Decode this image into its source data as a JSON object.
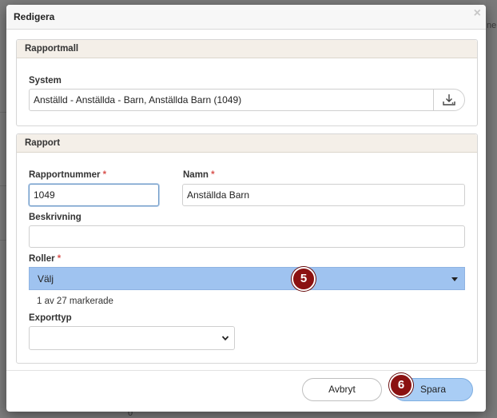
{
  "background": {
    "cut_text": "ne",
    "number": "0"
  },
  "dialog": {
    "title": "Redigera",
    "close_symbol": "×"
  },
  "section_template": {
    "heading": "Rapportmall",
    "system_label": "System",
    "system_value": "Anställd - Anställda - Barn, Anställda Barn (1049)"
  },
  "section_report": {
    "heading": "Rapport",
    "number_label": "Rapportnummer",
    "number_value": "1049",
    "name_label": "Namn",
    "name_value": "Anställda Barn",
    "description_label": "Beskrivning",
    "description_value": "",
    "roles_label": "Roller",
    "roles_selected": "Välj",
    "roles_count": "1 av 27 markerade",
    "export_label": "Exporttyp",
    "export_value": "",
    "required_mark": "*"
  },
  "footer": {
    "cancel_label": "Avbryt",
    "save_label": "Spara"
  },
  "annotations": {
    "badge_roles": "5",
    "badge_save": "6"
  },
  "colors": {
    "selected_bg": "#9fc3f0",
    "save_bg": "#a9cdf5",
    "badge_bg": "#8b1111",
    "required": "#d9534f"
  }
}
